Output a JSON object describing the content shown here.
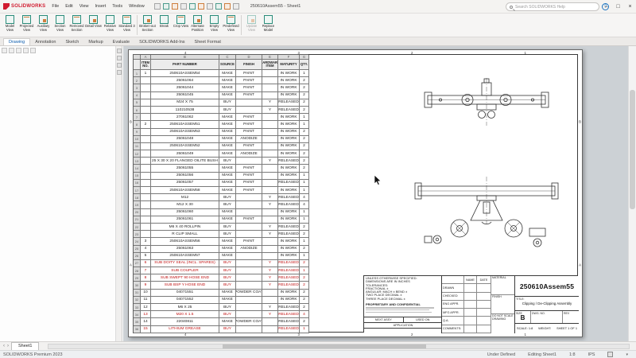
{
  "colors": {
    "logo_red": "#d01a2e",
    "bom_alert_red": "#c11111",
    "active_tab_blue": "#0b5cad",
    "canvas_gray": "#ccd1d5"
  },
  "titlebar": {
    "logo_text": "SOLIDWORKS",
    "menus": [
      "File",
      "Edit",
      "View",
      "Insert",
      "Tools",
      "Window"
    ],
    "qat_icons": [
      "new-file-icon",
      "open-file-icon",
      "save-icon",
      "print-icon",
      "undo-icon",
      "redo-icon",
      "select-icon",
      "rebuild-icon",
      "file-properties-icon",
      "options-icon"
    ],
    "doc_title": "250610Assem55 - Sheet1",
    "search_placeholder": "Search SOLIDWORKS Help",
    "help_icon": "?",
    "window_buttons": {
      "minimize": "–",
      "maximize": "□",
      "close": "×"
    }
  },
  "ribbon": {
    "buttons": [
      {
        "label": "Model View"
      },
      {
        "label": "Projected View"
      },
      {
        "label": "Auxiliary View"
      },
      {
        "label": "Section View"
      },
      {
        "label": "Removed Section"
      },
      {
        "label": "Detail View"
      },
      {
        "label": "Relative View"
      },
      {
        "label": "Standard 3 View"
      },
      {
        "label": "Broken-out Section"
      },
      {
        "label": "Break"
      },
      {
        "label": "Crop View"
      },
      {
        "label": "Alternate Position"
      },
      {
        "label": "Empty View"
      },
      {
        "label": "Predefined View"
      },
      {
        "label": "Update View",
        "disabled": true
      },
      {
        "label": "Replace Model"
      }
    ],
    "separators_after": [
      7,
      13
    ]
  },
  "command_tabs": {
    "items": [
      "Drawing",
      "Annotation",
      "Sketch",
      "Markup",
      "Evaluate",
      "SOLIDWORKS Add-Ins",
      "Sheet Format"
    ],
    "active": "Drawing"
  },
  "bom": {
    "column_letters": [
      "A",
      "B",
      "C",
      "D",
      "E",
      "F",
      "G"
    ],
    "headers": [
      "ITEM NO.",
      "PART NUMBER",
      "SOURCE",
      "FINISH",
      "HARDWARE ITEM",
      "MATURITY",
      "QTY."
    ],
    "red_row_indices": [
      26,
      27,
      28,
      29,
      33,
      35
    ],
    "rows": [
      [
        "1",
        "250610ASSEM54",
        "MAKE",
        "PAINT",
        "",
        "IN WORK",
        "1"
      ],
      [
        "",
        "25061064",
        "MAKE",
        "PAINT",
        "",
        "IN WORK",
        "2"
      ],
      [
        "",
        "25061044",
        "MAKE",
        "PAINT",
        "",
        "IN WORK",
        "2"
      ],
      [
        "",
        "25061045",
        "MAKE",
        "PAINT",
        "",
        "IN WORK",
        "2"
      ],
      [
        "",
        "M24 X 75",
        "BUY",
        "",
        "Y",
        "RELEASED",
        "2"
      ],
      [
        "",
        "110210538",
        "BUY",
        "",
        "Y",
        "RELEASED",
        "2"
      ],
      [
        "",
        "27061062",
        "MAKE",
        "PAINT",
        "",
        "IN WORK",
        "1"
      ],
      [
        "2",
        "250610ASSEM51",
        "MAKE",
        "PAINT",
        "",
        "IN WORK",
        "1"
      ],
      [
        "",
        "250610ASSEM53",
        "MAKE",
        "PAINT",
        "",
        "IN WORK",
        "2"
      ],
      [
        "",
        "25061048",
        "MAKE",
        "ANODIZE",
        "",
        "IN WORK",
        "2"
      ],
      [
        "",
        "250610ASSEM52",
        "MAKE",
        "PAINT",
        "",
        "IN WORK",
        "2"
      ],
      [
        "",
        "25061049",
        "MAKE",
        "ANODIZE",
        "",
        "IN WORK",
        "2"
      ],
      [
        "",
        "25 X 30 X 20 FLANGED OILITE BUSH",
        "BUY",
        "",
        "Y",
        "RELEASED",
        "2"
      ],
      [
        "",
        "25061055",
        "MAKE",
        "PAINT",
        "",
        "IN WORK",
        "2"
      ],
      [
        "",
        "25061056",
        "MAKE",
        "PAINT",
        "",
        "IN WORK",
        "1"
      ],
      [
        "",
        "25061057",
        "MAKE",
        "PAINT",
        "",
        "RELEASED",
        "1"
      ],
      [
        "",
        "250610ASSEM58",
        "MAKE",
        "PAINT",
        "",
        "IN WORK",
        "1"
      ],
      [
        "",
        "M12",
        "BUY",
        "",
        "Y",
        "RELEASED",
        "4"
      ],
      [
        "",
        "M12 X 30",
        "BUY",
        "",
        "Y",
        "RELEASED",
        "4"
      ],
      [
        "",
        "25061060",
        "MAKE",
        "",
        "",
        "IN WORK",
        "1"
      ],
      [
        "",
        "25061061",
        "MAKE",
        "PAINT",
        "",
        "IN WORK",
        "1"
      ],
      [
        "",
        "M6 X 40 ROLLPIN",
        "BUY",
        "",
        "Y",
        "RELEASED",
        "2"
      ],
      [
        "",
        "R CLIP SMALL",
        "BUY",
        "",
        "Y",
        "RELEASED",
        "2"
      ],
      [
        "3",
        "250610ASSEM56",
        "MAKE",
        "PAINT",
        "",
        "IN WORK",
        "1"
      ],
      [
        "4",
        "25061063",
        "MAKE",
        "ANODIZE",
        "",
        "IN WORK",
        "2"
      ],
      [
        "5",
        "250610ASSEM57",
        "MAKE",
        "",
        "",
        "IN WORK",
        "1"
      ],
      [
        "6",
        "SUB DOITY SEAL (INCL. SPARES)",
        "BUY",
        "",
        "Y",
        "RELEASED",
        "2"
      ],
      [
        "7",
        "SUB COUPLER",
        "BUY",
        "",
        "Y",
        "RELEASED",
        "1"
      ],
      [
        "8",
        "SUB SWEPT 90 HOSE END",
        "BUY",
        "",
        "Y",
        "RELEASED",
        "2"
      ],
      [
        "9",
        "SUB BSP Y HOSE END",
        "BUY",
        "",
        "Y",
        "RELEASED",
        "2"
      ],
      [
        "10",
        "04071551",
        "MAKE",
        "POWDER COAT",
        "",
        "IN WORK",
        "2"
      ],
      [
        "11",
        "04071552",
        "MAKE",
        "",
        "",
        "IN WORK",
        "2"
      ],
      [
        "12",
        "M6 X 25",
        "BUY",
        "",
        "Y",
        "RELEASED",
        "2"
      ],
      [
        "13",
        "M20 X 1.5",
        "BUY",
        "",
        "Y",
        "RELEASED",
        "4"
      ],
      [
        "14",
        "22040811",
        "MAKE",
        "POWDER COAT",
        "",
        "RELEASED",
        "2"
      ],
      [
        "15",
        "LITHIUM GREASE",
        "BUY",
        "",
        "",
        "RELEASED",
        "1"
      ]
    ]
  },
  "sheet": {
    "zone_columns": [
      "4",
      "3",
      "2",
      "1"
    ],
    "zone_rows": [
      "B",
      "A"
    ]
  },
  "title_block": {
    "drawing_number": "250610Assem55",
    "title_label": "TITLE:",
    "title": "Clipping / De-Clipping Assembly",
    "size_label": "SIZE",
    "size": "B",
    "dwg_no_label": "DWG.  NO.",
    "rev_label": "REV",
    "scale": "SCALE: 1:8",
    "weight": "WEIGHT:",
    "sheet": "SHEET 1 OF 1",
    "name_col": "NAME",
    "date_col": "DATE",
    "approval_rows": [
      "DRAWN",
      "CHECKED",
      "ENG APPR.",
      "MFG APPR.",
      "Q.A.",
      "COMMENTS:"
    ],
    "tolerance_lines": [
      "UNLESS OTHERWISE SPECIFIED:",
      "DIMENSIONS ARE IN INCHES",
      "TOLERANCES:",
      "FRACTIONAL ±",
      "ANGULAR: MACH ±   BEND ±",
      "TWO PLACE DECIMAL    ±",
      "THREE PLACE DECIMAL  ±"
    ],
    "proprietary": "PROPRIETARY AND CONFIDENTIAL",
    "material_label": "MATERIAL",
    "finish_label": "FINISH",
    "do_not_scale": "DO NOT SCALE DRAWING",
    "next_assy": "NEXT ASSY",
    "used_on": "USED ON",
    "application": "APPLICATION"
  },
  "sheet_tabs": {
    "nav": [
      "‹",
      "›"
    ],
    "items": [
      "Sheet1"
    ],
    "active": "Sheet1"
  },
  "statusbar": {
    "left": "SOLIDWORKS Premium 2023",
    "items": [
      "Under Defined",
      "Editing Sheet1",
      "1:8",
      "IPS"
    ],
    "caret": "▾"
  }
}
